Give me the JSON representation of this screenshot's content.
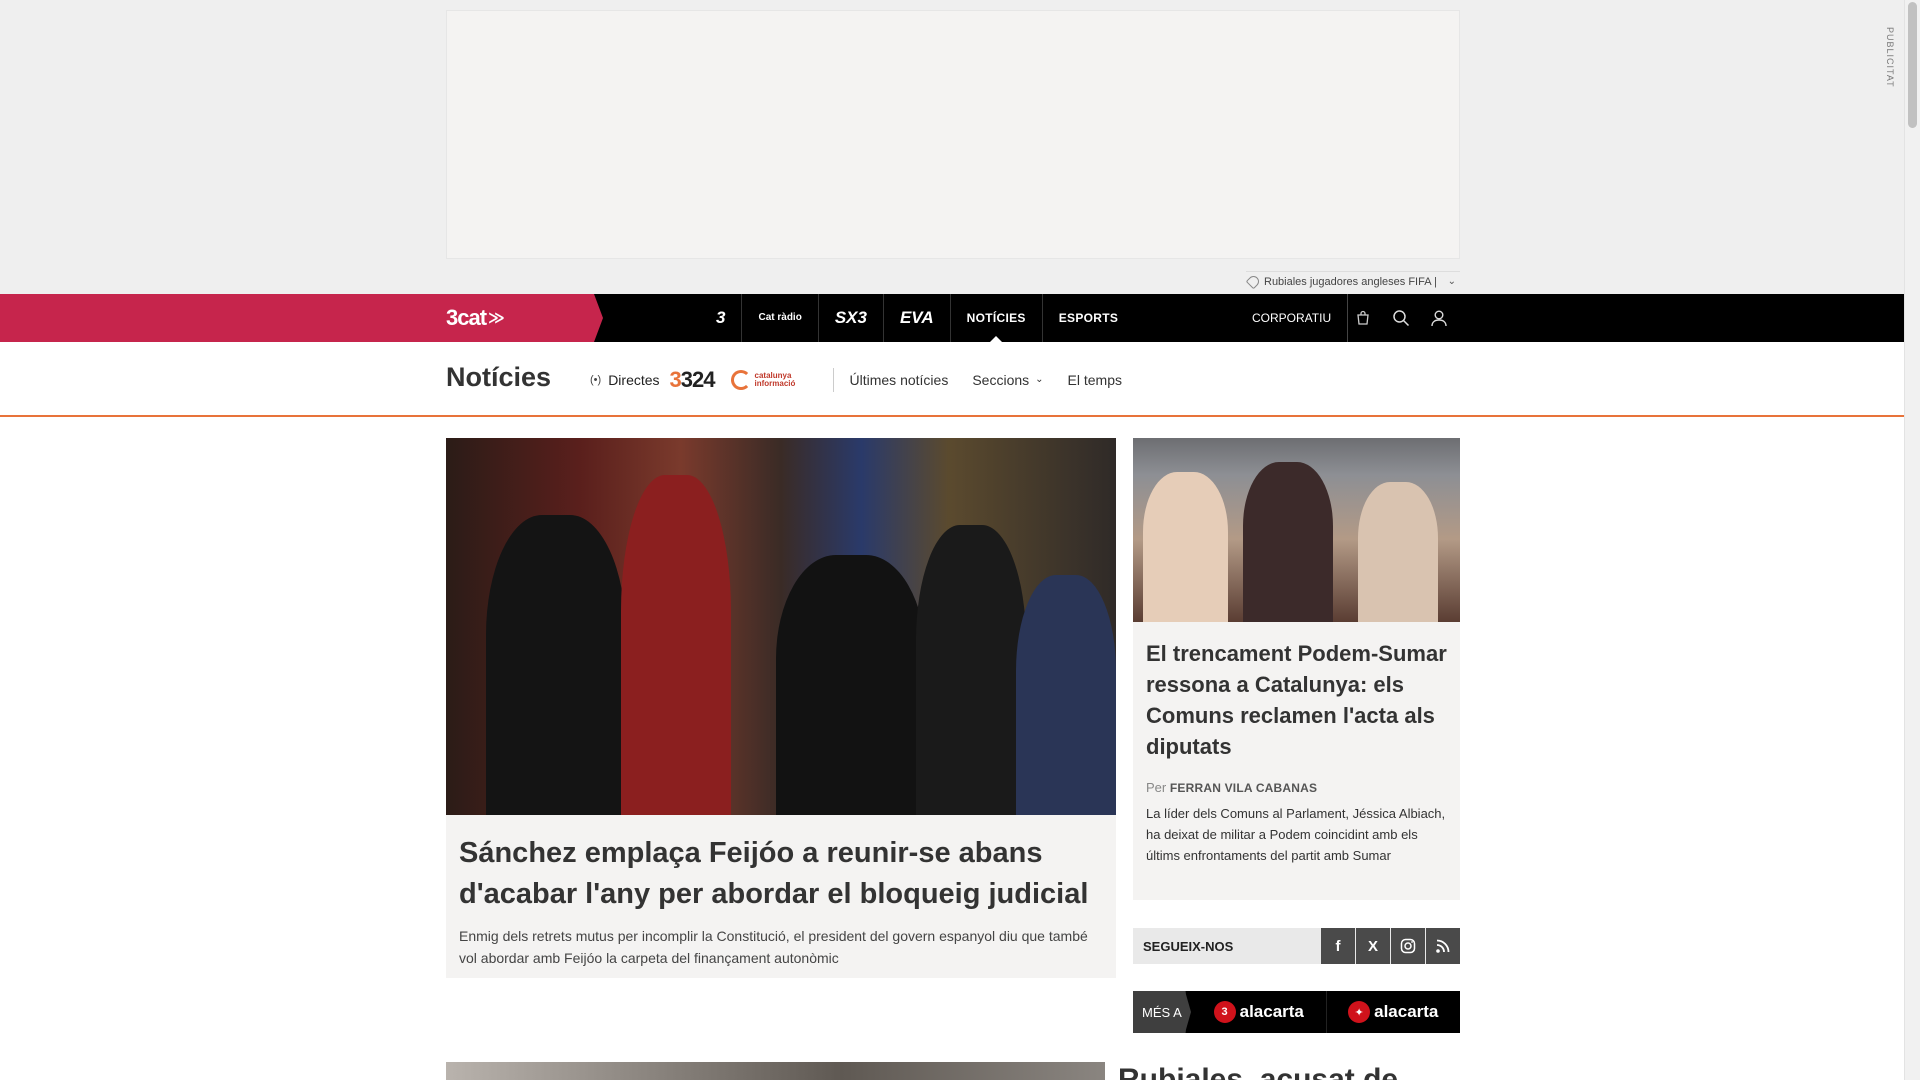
{
  "ad": {
    "label": "PUBLICITAT",
    "tag_text": "Rubiales jugadores angleses FIFA |"
  },
  "topbar": {
    "brand": "3cat",
    "channels": [
      {
        "label": "3",
        "icon": "tv3-logo"
      },
      {
        "label": "Cat ràdio",
        "icon": "catradio-logo"
      },
      {
        "label": "SX3",
        "icon": "sx3-logo"
      },
      {
        "label": "EVA",
        "icon": "eva-logo"
      },
      {
        "label": "NOTÍCIES",
        "active": true
      },
      {
        "label": "ESPORTS"
      }
    ],
    "corporate": "CORPORATIU",
    "tools": [
      "cart-icon",
      "search-icon",
      "user-icon"
    ]
  },
  "section": {
    "title": "Notícies",
    "directes": "Directes",
    "logo_324": "324",
    "logo_ci": "catalunya informació",
    "links": [
      "Últimes notícies",
      "Seccions",
      "El temps"
    ]
  },
  "main_article": {
    "title": "Sánchez emplaça Feijóo a reunir-se abans d'acabar l'any per abordar el bloqueig judicial",
    "summary": "Enmig dels retrets mutus per incomplir la Constitució, el president del govern espanyol diu que també vol abordar amb Feijóo la carpeta del finançament autonòmic"
  },
  "side_article": {
    "title": "El trencament Podem-Sumar ressona a Catalunya: els Comuns reclamen l'acta als diputats",
    "byline_prefix": "Per",
    "author": "FERRAN VILA CABANAS",
    "summary": "La líder dels Comuns al Parlament, Jéssica Albiach, ha deixat de militar a Podem coincidint amb els últims enfrontaments del partit amb Sumar"
  },
  "follow": {
    "label": "SEGUEIX-NOS",
    "networks": [
      "facebook-icon",
      "x-icon",
      "instagram-icon",
      "rss-icon"
    ]
  },
  "alacarta": {
    "more_label": "MÉS A",
    "buttons": [
      {
        "badge": "3",
        "label": "alacarta"
      },
      {
        "badge": "✦",
        "label": "alacarta"
      }
    ]
  },
  "next": {
    "title_peek": "Rubiales, acusat de"
  }
}
